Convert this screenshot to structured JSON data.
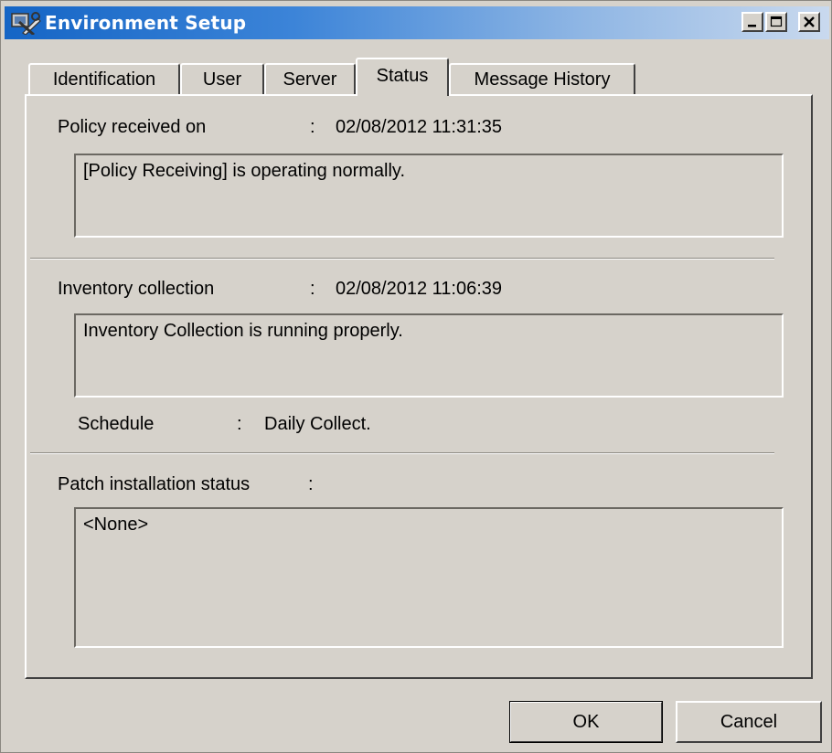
{
  "window": {
    "title": "Environment Setup",
    "icon": "app-tools-icon"
  },
  "caption_buttons": {
    "minimize": "minimize-icon",
    "maximize": "maximize-icon",
    "close": "close-icon"
  },
  "tabs": [
    {
      "label": "Identification",
      "active": false
    },
    {
      "label": "User",
      "active": false
    },
    {
      "label": "Server",
      "active": false
    },
    {
      "label": "Status",
      "active": true
    },
    {
      "label": "Message History",
      "active": false
    }
  ],
  "status": {
    "policy": {
      "label": "Policy received on",
      "separator": ":",
      "value": "02/08/2012 11:31:35",
      "message": "[Policy Receiving] is operating normally."
    },
    "inventory": {
      "label": "Inventory collection",
      "separator": ":",
      "value": "02/08/2012 11:06:39",
      "message": "Inventory Collection is running properly."
    },
    "schedule": {
      "label": "Schedule",
      "separator": ":",
      "value": "Daily Collect."
    },
    "patch": {
      "label": "Patch installation status",
      "separator": ":",
      "message": "<None>"
    }
  },
  "buttons": {
    "ok": "OK",
    "cancel": "Cancel"
  }
}
